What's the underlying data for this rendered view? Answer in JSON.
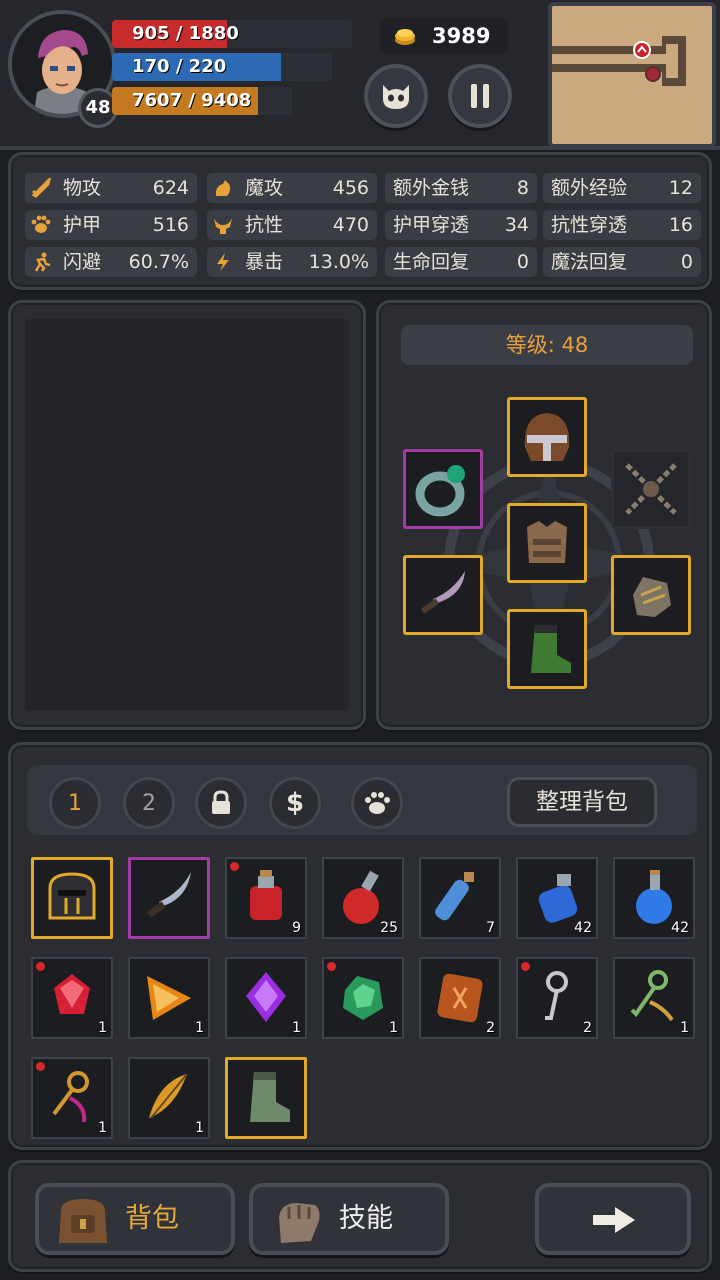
{
  "player": {
    "level": "48",
    "hp": "905 / 1880",
    "hp_fraction": 0.48,
    "mp": "170 / 220",
    "mp_fraction": 0.77,
    "xp": "7607 / 9408",
    "xp_fraction": 0.81
  },
  "gold": "3989",
  "stats": [
    {
      "icon": "sword-icon",
      "label": "物攻",
      "value": "624"
    },
    {
      "icon": "magic-hand-icon",
      "label": "魔攻",
      "value": "456"
    },
    {
      "icon": "",
      "label": "额外金钱",
      "value": "8"
    },
    {
      "icon": "",
      "label": "额外经验",
      "value": "12"
    },
    {
      "icon": "paw-icon",
      "label": "护甲",
      "value": "516"
    },
    {
      "icon": "horns-icon",
      "label": "抗性",
      "value": "470"
    },
    {
      "icon": "",
      "label": "护甲穿透",
      "value": "34"
    },
    {
      "icon": "",
      "label": "抗性穿透",
      "value": "16"
    },
    {
      "icon": "running-icon",
      "label": "闪避",
      "value": "60.7%"
    },
    {
      "icon": "lightning-icon",
      "label": "暴击",
      "value": "13.0%"
    },
    {
      "icon": "",
      "label": "生命回复",
      "value": "0"
    },
    {
      "icon": "",
      "label": "魔法回复",
      "value": "0"
    }
  ],
  "equipment": {
    "level_label": "等级: 48",
    "slots": [
      "helmet-icon",
      "ring-icon",
      "chains-icon",
      "armor-icon",
      "dagger-icon",
      "gauntlet-icon",
      "boots-icon"
    ]
  },
  "inventory": {
    "tabs": [
      "1",
      "2"
    ],
    "sort_label": "整理背包",
    "items": [
      {
        "icon": "helmet-icon",
        "count": ""
      },
      {
        "icon": "curved-dagger-icon",
        "count": ""
      },
      {
        "icon": "red-potion-icon",
        "count": "9"
      },
      {
        "icon": "red-flask-icon",
        "count": "25"
      },
      {
        "icon": "blue-vial-icon",
        "count": "7"
      },
      {
        "icon": "blue-potion-icon",
        "count": "42"
      },
      {
        "icon": "blue-flask-icon",
        "count": "42"
      },
      {
        "icon": "red-gem-icon",
        "count": "1"
      },
      {
        "icon": "orange-gem-icon",
        "count": "1"
      },
      {
        "icon": "purple-gem-icon",
        "count": "1"
      },
      {
        "icon": "green-gem-icon",
        "count": "1"
      },
      {
        "icon": "rune-tablet-icon",
        "count": "2"
      },
      {
        "icon": "silver-key-icon",
        "count": "2"
      },
      {
        "icon": "green-key-icon",
        "count": "1"
      },
      {
        "icon": "gold-key-icon",
        "count": "1"
      },
      {
        "icon": "feather-icon",
        "count": "1"
      },
      {
        "icon": "green-boots-icon",
        "count": ""
      }
    ]
  },
  "bottom": {
    "bag_label": "背包",
    "skill_label": "技能"
  }
}
